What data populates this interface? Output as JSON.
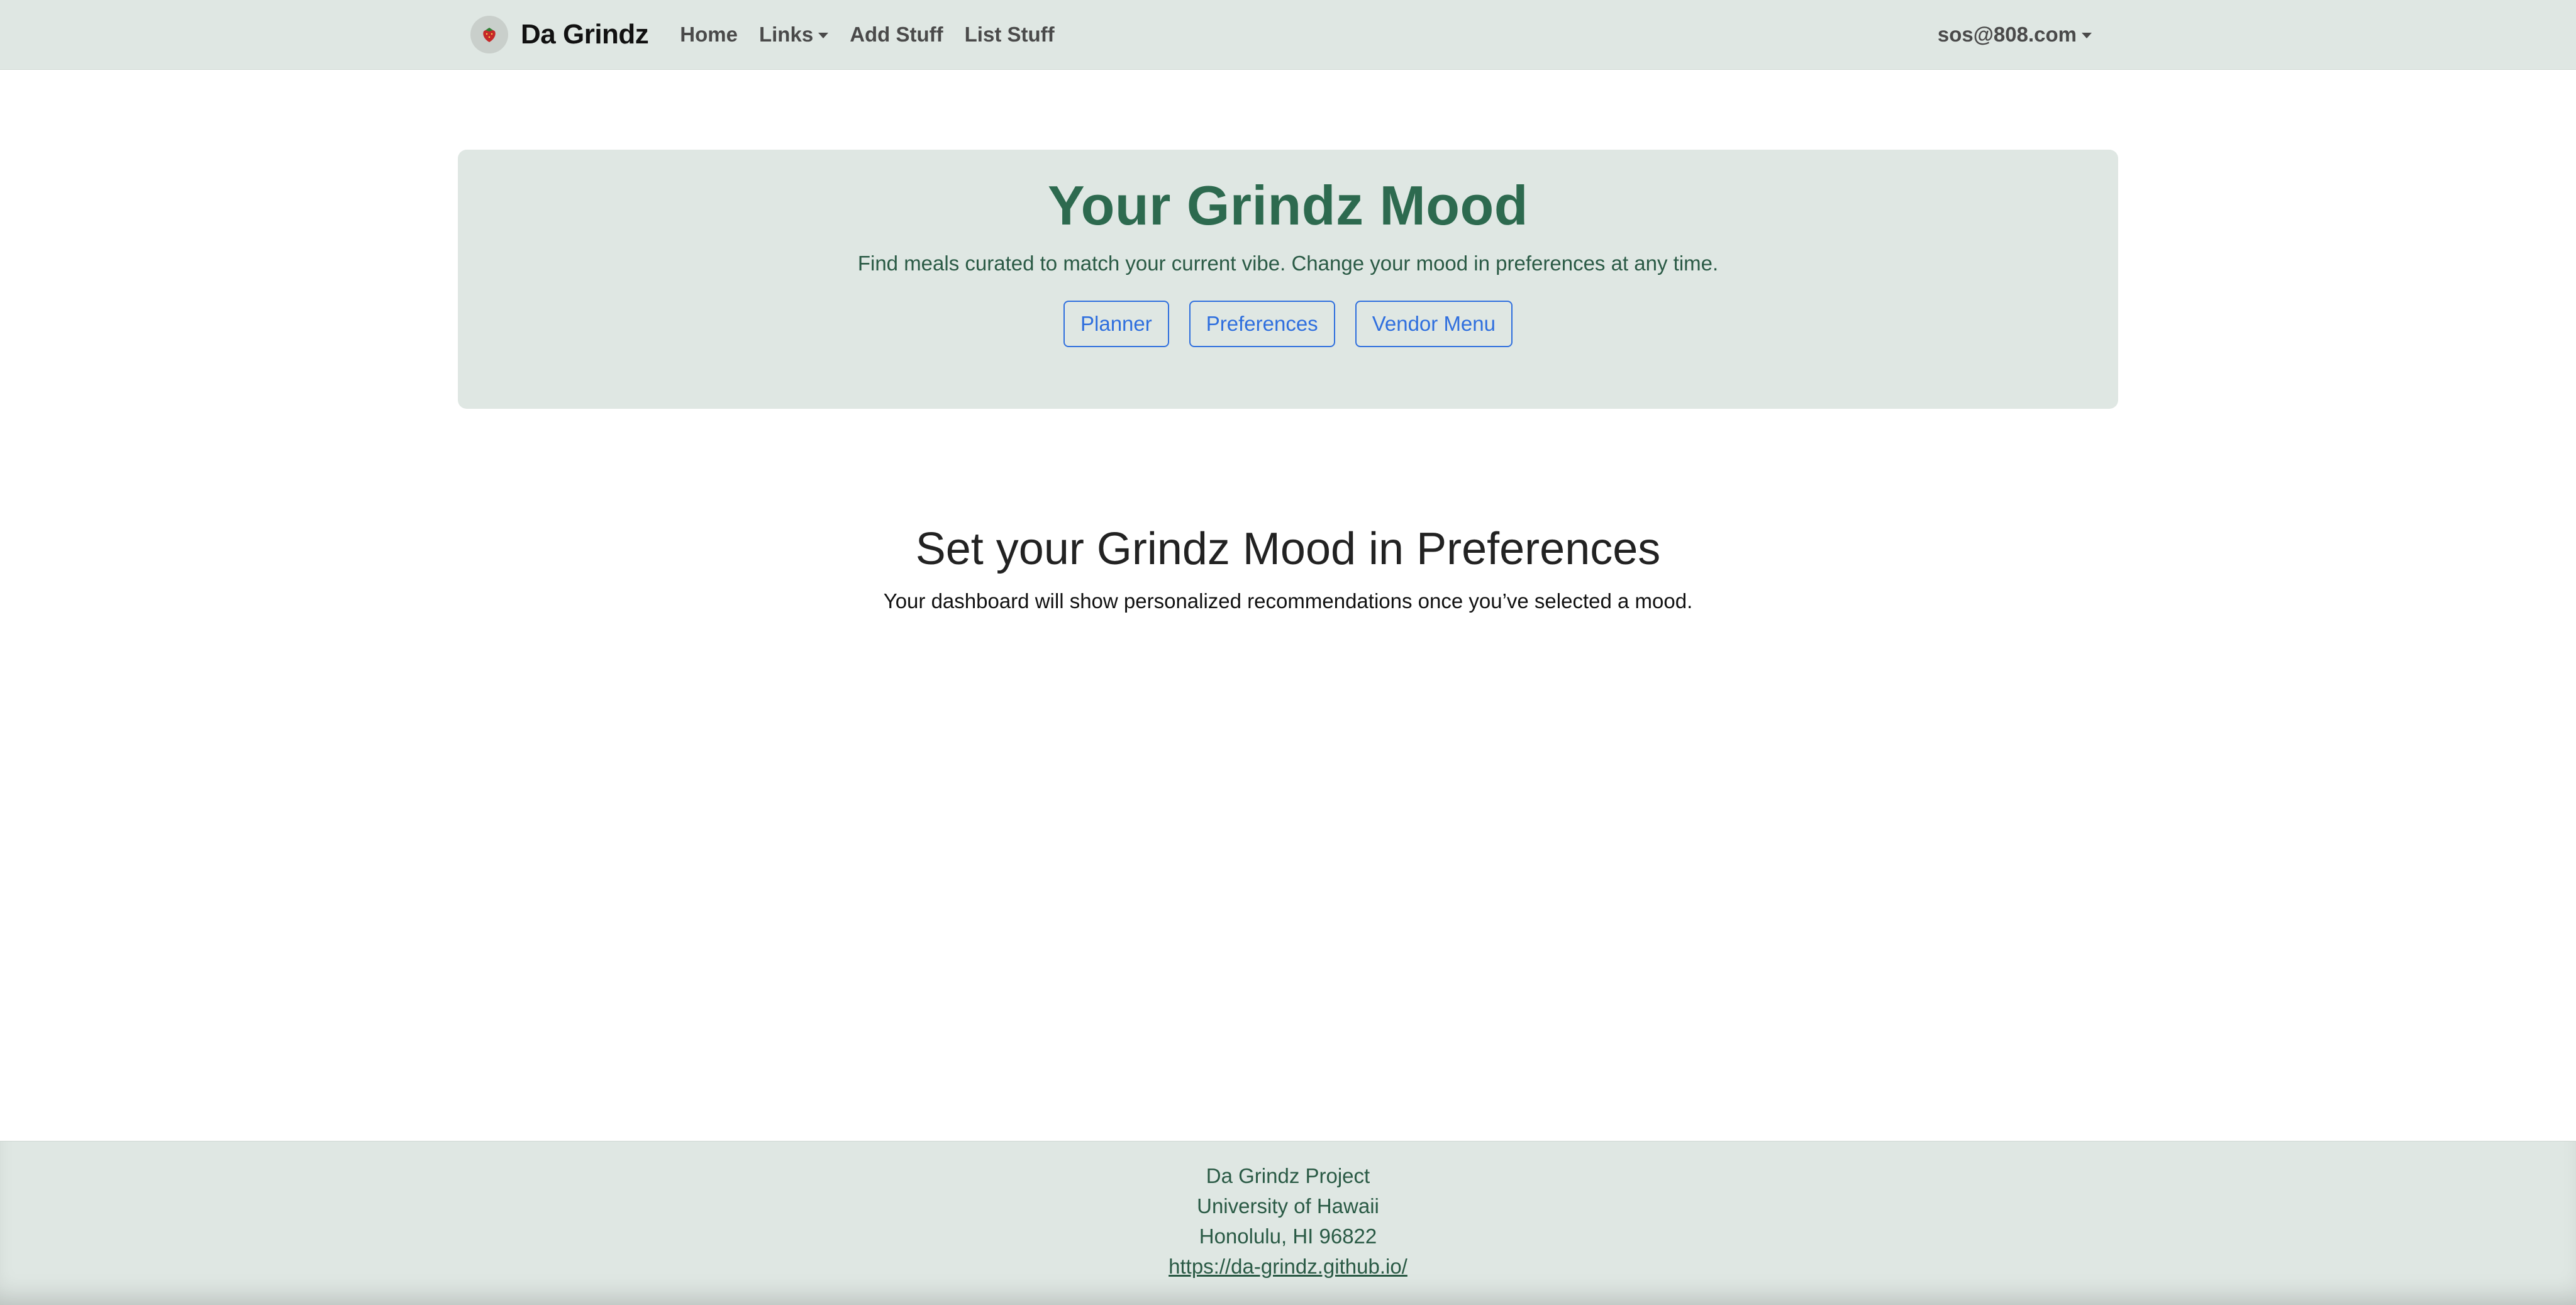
{
  "navbar": {
    "brand_text": "Da Grindz",
    "brand_icon": "strawberry-logo-icon",
    "links": [
      {
        "label": "Home"
      },
      {
        "label": "Links",
        "dropdown": true
      },
      {
        "label": "Add Stuff"
      },
      {
        "label": "List Stuff"
      }
    ],
    "user_email": "sos@808.com"
  },
  "hero": {
    "title": "Your Grindz Mood",
    "subtitle": "Find meals curated to match your current vibe. Change your mood in preferences at any time.",
    "buttons": [
      {
        "label": "Planner"
      },
      {
        "label": "Preferences"
      },
      {
        "label": "Vendor Menu"
      }
    ]
  },
  "mood_prompt": {
    "title": "Set your Grindz Mood in Preferences",
    "description": "Your dashboard will show personalized recommendations once you’ve selected a mood."
  },
  "footer": {
    "line1": "Da Grindz Project",
    "line2": "University of Hawaii",
    "line3": "Honolulu, HI 96822",
    "link": "https://da-grindz.github.io/"
  },
  "colors": {
    "bar_background": "#dfe7e3",
    "hero_title": "#2d6a4f",
    "button_accent": "#2f6fde"
  }
}
